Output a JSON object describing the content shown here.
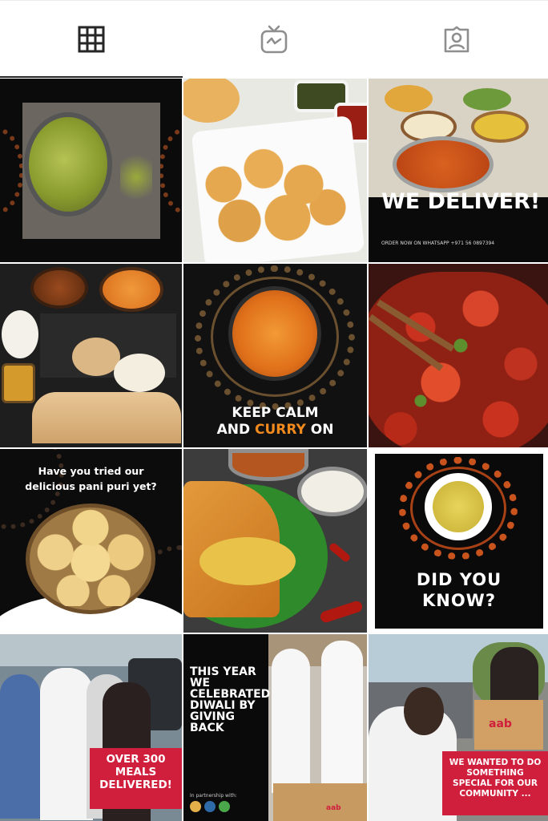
{
  "tabs": [
    {
      "label": "Posts",
      "icon": "grid-icon",
      "active": true
    },
    {
      "label": "IGTV",
      "icon": "igtv-icon",
      "active": false
    },
    {
      "label": "Tagged",
      "icon": "tagged-icon",
      "active": false
    }
  ],
  "posts": {
    "p3": {
      "headline": "WE DELIVER!",
      "sub": "ORDER NOW ON WHATSAPP +971 56 0897394"
    },
    "p5": {
      "line1": "KEEP CALM",
      "line2_a": "AND ",
      "line2_b": "CURRY",
      "line2_c": " ON"
    },
    "p7": {
      "line1": "Have you tried our",
      "line2": "delicious pani puri yet?"
    },
    "p9": {
      "line1": "DID YOU",
      "line2": "KNOW?"
    },
    "p10": {
      "line1": "OVER 300",
      "line2": "MEALS",
      "line3": "DELIVERED!"
    },
    "p11": {
      "line1": "THIS YEAR",
      "line2": "WE",
      "line3": "CELEBRATED",
      "line4": "DIWALI BY",
      "line5": "GIVING",
      "line6": "BACK",
      "partner": "In partnership with:",
      "box_brand": "aab"
    },
    "p12": {
      "line1": "WE WANTED TO DO",
      "line2": "SOMETHING",
      "line3": "SPECIAL FOR OUR",
      "line4": "COMMUNITY ...",
      "box_brand": "aab"
    }
  },
  "colors": {
    "accent_red": "#d01f3c",
    "curry_orange": "#f28a1e",
    "tab_icon": "#262626",
    "tab_icon_inactive": "#8e8e8e"
  }
}
